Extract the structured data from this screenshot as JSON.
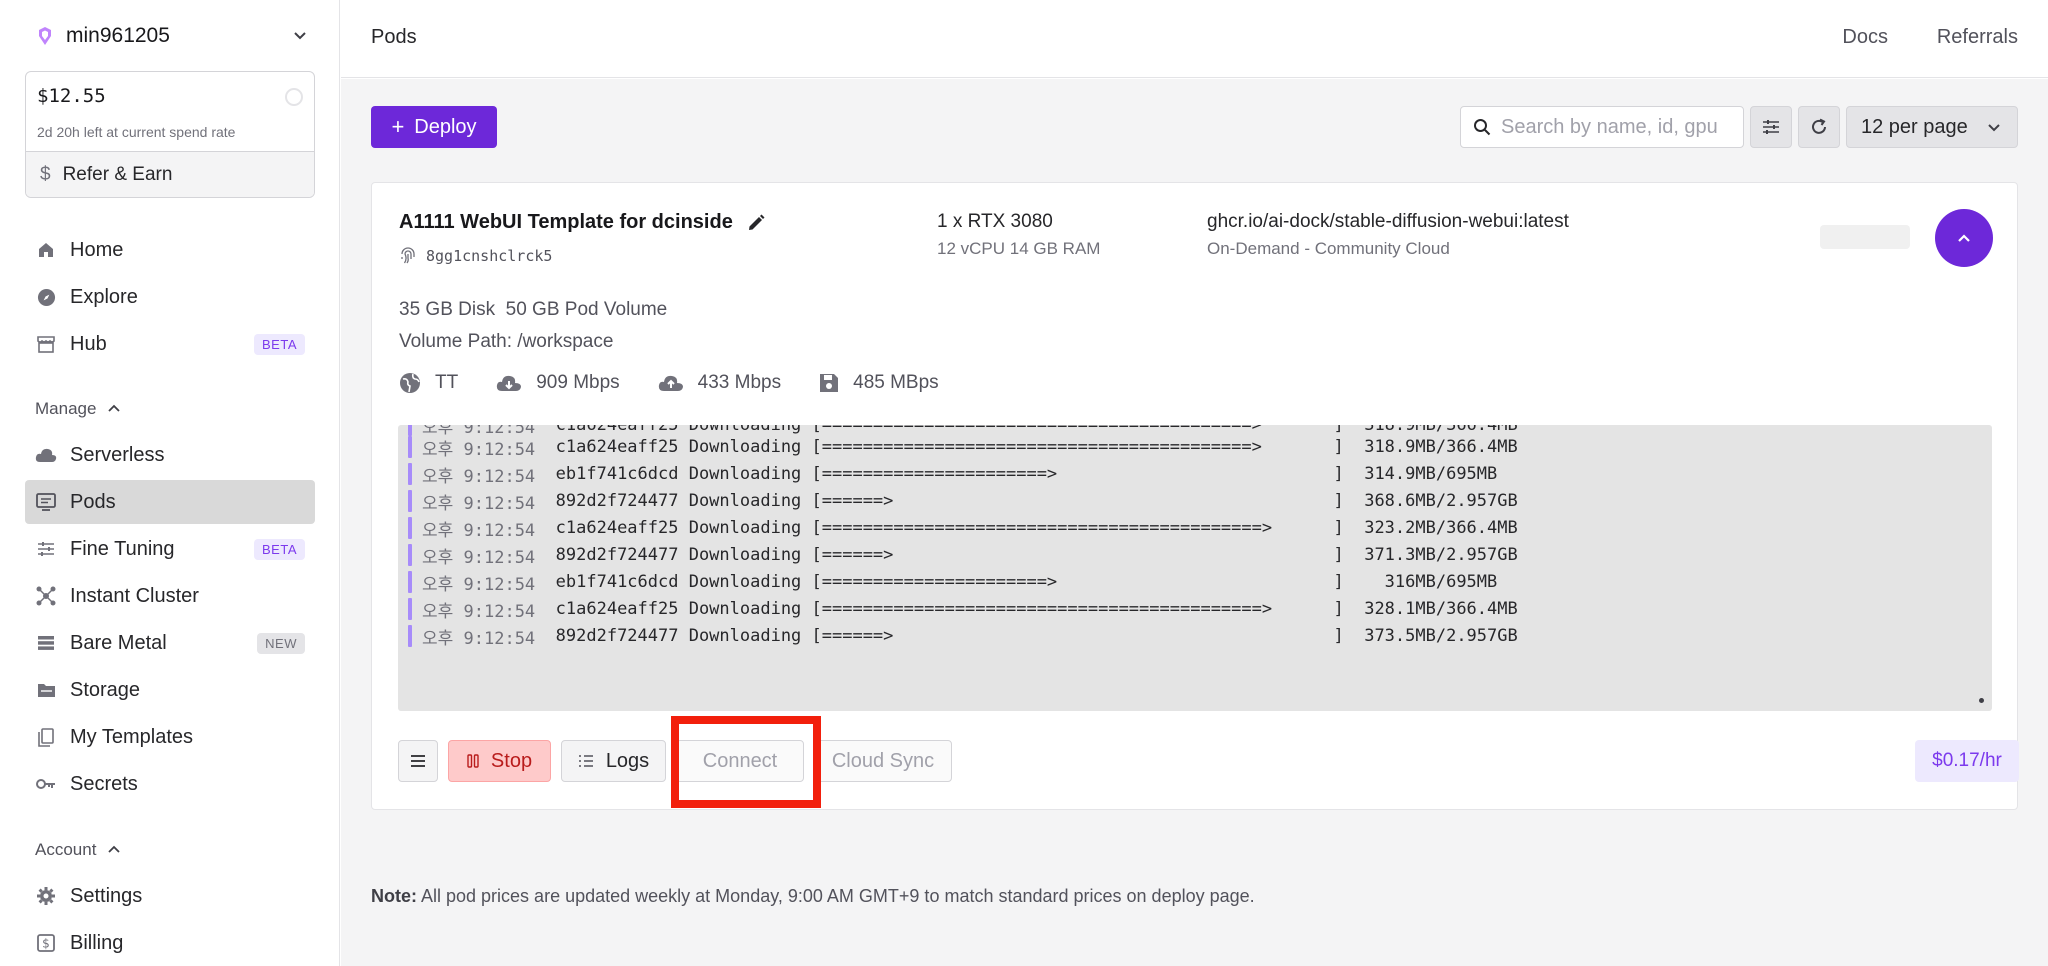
{
  "account": {
    "name": "min961205"
  },
  "balance": {
    "amount": "$12.55",
    "time_left": "2d 20h left at current spend rate",
    "refer_label": "Refer & Earn"
  },
  "nav": {
    "home": "Home",
    "explore": "Explore",
    "hub": "Hub",
    "hub_badge": "BETA",
    "manage_label": "Manage",
    "serverless": "Serverless",
    "pods": "Pods",
    "fine_tuning": "Fine Tuning",
    "fine_tuning_badge": "BETA",
    "instant_cluster": "Instant Cluster",
    "bare_metal": "Bare Metal",
    "bare_metal_badge": "NEW",
    "storage": "Storage",
    "my_templates": "My Templates",
    "secrets": "Secrets",
    "account_label": "Account",
    "settings": "Settings",
    "billing": "Billing"
  },
  "header": {
    "title": "Pods",
    "docs": "Docs",
    "referrals": "Referrals"
  },
  "toolbar": {
    "deploy_label": "Deploy",
    "search_placeholder": "Search by name, id, gpu",
    "per_page": "12 per page"
  },
  "pod": {
    "name": "A1111 WebUI Template for dcinside",
    "id": "8gg1cnshclrck5",
    "gpu": "1 x RTX 3080",
    "specs": "12 vCPU 14 GB RAM",
    "image": "ghcr.io/ai-dock/stable-diffusion-webui:latest",
    "cloud": "On-Demand - Community Cloud",
    "disk": "35 GB Disk  50 GB Pod Volume",
    "volume_path": "Volume Path: /workspace",
    "region": "TT",
    "download": "909 Mbps",
    "upload": "433 Mbps",
    "disk_speed": "485 MBps",
    "price": "$0.17/hr"
  },
  "logs": [
    {
      "time": "오후 9:12:54",
      "msg": "c1a624eaff25 Downloading [==========================================>       ]  318.9MB/366.4MB"
    },
    {
      "time": "오후 9:12:54",
      "msg": "eb1f741c6dcd Downloading [======================>                           ]  314.9MB/695MB"
    },
    {
      "time": "오후 9:12:54",
      "msg": "892d2f724477 Downloading [======>                                           ]  368.6MB/2.957GB"
    },
    {
      "time": "오후 9:12:54",
      "msg": "c1a624eaff25 Downloading [===========================================>      ]  323.2MB/366.4MB"
    },
    {
      "time": "오후 9:12:54",
      "msg": "892d2f724477 Downloading [======>                                           ]  371.3MB/2.957GB"
    },
    {
      "time": "오후 9:12:54",
      "msg": "eb1f741c6dcd Downloading [======================>                           ]    316MB/695MB"
    },
    {
      "time": "오후 9:12:54",
      "msg": "c1a624eaff25 Downloading [===========================================>      ]  328.1MB/366.4MB"
    },
    {
      "time": "오후 9:12:54",
      "msg": "892d2f724477 Downloading [======>                                           ]  373.5MB/2.957GB"
    }
  ],
  "actions": {
    "stop": "Stop",
    "logs": "Logs",
    "connect": "Connect",
    "cloud_sync": "Cloud Sync"
  },
  "note": {
    "label": "Note:",
    "text": " All pod prices are updated weekly at Monday, 9:00 AM GMT+9 to match standard prices on deploy page."
  },
  "colors": {
    "accent": "#6d28d9",
    "highlight": "#f21f0c",
    "stop_bg": "#fecaca"
  }
}
